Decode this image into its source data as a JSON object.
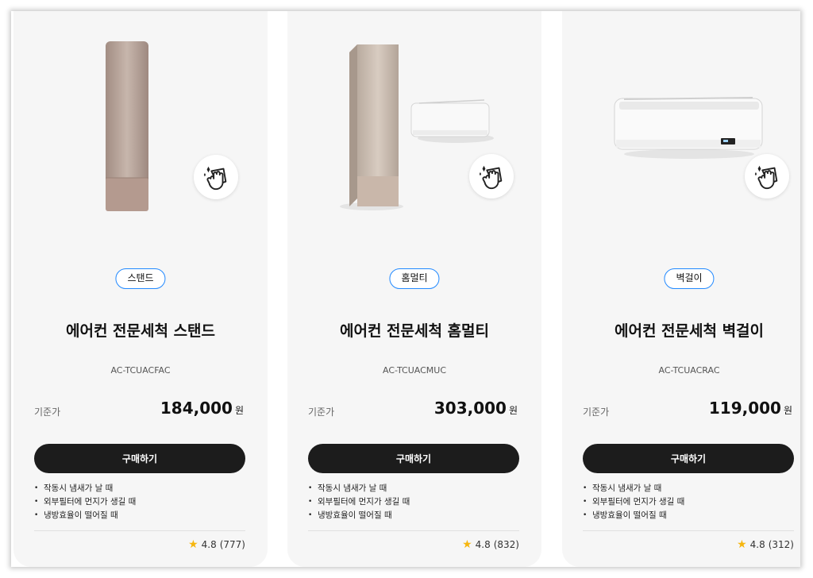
{
  "colors": {
    "accent_blue": "#2189ff",
    "button_dark": "#1c1c1c",
    "star": "#f6b60e",
    "card_bg": "#f6f6f6"
  },
  "products": [
    {
      "type": "스탠드",
      "title": "에어컨 전문세척 스탠드",
      "model": "AC-TCUACFAC",
      "price_label": "기준가",
      "price": "184,000",
      "currency": "원",
      "buy": "구매하기",
      "bullets": [
        "작동시 냄새가 날 때",
        "외부필터에 먼지가 생길 때",
        "냉방효율이 떨어질 때"
      ],
      "rating": "4.8",
      "reviews": "(777)",
      "icon": "cleaning-cloth-icon"
    },
    {
      "type": "홈멀티",
      "title": "에어컨 전문세척 홈멀티",
      "model": "AC-TCUACMUC",
      "price_label": "기준가",
      "price": "303,000",
      "currency": "원",
      "buy": "구매하기",
      "bullets": [
        "작동시 냄새가 날 때",
        "외부필터에 먼지가 생길 때",
        "냉방효율이 떨어질 때"
      ],
      "rating": "4.8",
      "reviews": "(832)",
      "icon": "cleaning-cloth-icon"
    },
    {
      "type": "벽걸이",
      "title": "에어컨 전문세척 벽걸이",
      "model": "AC-TCUACRAC",
      "price_label": "기준가",
      "price": "119,000",
      "currency": "원",
      "buy": "구매하기",
      "bullets": [
        "작동시 냄새가 날 때",
        "외부필터에 먼지가 생길 때",
        "냉방효율이 떨어질 때"
      ],
      "rating": "4.8",
      "reviews": "(312)",
      "icon": "cleaning-cloth-icon"
    }
  ]
}
